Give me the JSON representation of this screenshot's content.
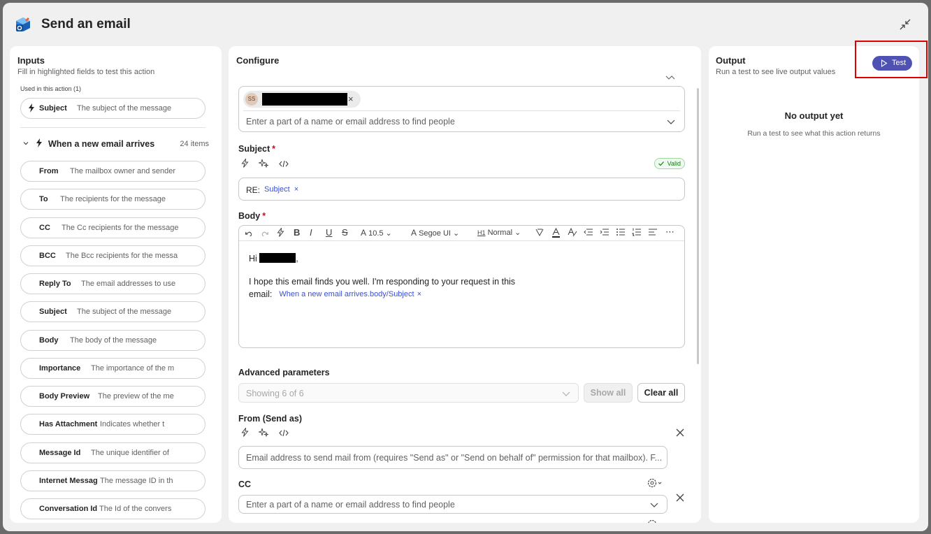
{
  "dialog": {
    "title": "Send an email",
    "app_icon": "outlook-cube-icon",
    "collapse_icon": "collapse-arrows-icon"
  },
  "inputs": {
    "title": "Inputs",
    "subtitle": "Fill in highlighted fields to test this action",
    "used_label": "Used in this action (1)",
    "used_items": [
      {
        "name": "Subject",
        "desc": "The subject of the message"
      }
    ],
    "group": {
      "label": "When a new email arrives",
      "count": "24 items"
    },
    "items": [
      {
        "name": "From",
        "desc": "The mailbox owner and sender"
      },
      {
        "name": "To",
        "desc": "The recipients for the message"
      },
      {
        "name": "CC",
        "desc": "The Cc recipients for the message"
      },
      {
        "name": "BCC",
        "desc": "The Bcc recipients for the messa"
      },
      {
        "name": "Reply To",
        "desc": "The email addresses to use"
      },
      {
        "name": "Subject",
        "desc": "The subject of the message"
      },
      {
        "name": "Body",
        "desc": "The body of the message"
      },
      {
        "name": "Importance",
        "desc": "The importance of the m"
      },
      {
        "name": "Body Preview",
        "desc": "The preview of the me"
      },
      {
        "name": "Has Attachment",
        "desc": "Indicates whether t"
      },
      {
        "name": "Message Id",
        "desc": "The unique identifier of"
      },
      {
        "name": "Internet Messag",
        "desc": "The message ID in th"
      },
      {
        "name": "Conversation Id",
        "desc": "The Id of the convers"
      }
    ]
  },
  "configure": {
    "title": "Configure",
    "to": {
      "chip_initials": "SS",
      "placeholder": "Enter a part of a name or email address to find people"
    },
    "subject": {
      "label": "Subject",
      "required_mark": "*",
      "valid_label": "Valid",
      "prefix": "RE:",
      "token": "Subject",
      "token_remove": "×"
    },
    "body": {
      "label": "Body",
      "required_mark": "*",
      "font_size": "10.5",
      "font_name": "Segoe UI",
      "style": "Normal",
      "greeting": "Hi",
      "greeting_suffix": ",",
      "line1": "I hope this email finds you well. I'm responding to your request in this",
      "line2": "email:",
      "token": "When a new email arrives.body/Subject",
      "token_remove": "×"
    },
    "advanced": {
      "label": "Advanced parameters",
      "dropdown_value": "Showing 6 of 6",
      "show_all": "Show all",
      "clear_all": "Clear all"
    },
    "from": {
      "label": "From (Send as)",
      "placeholder": "Email address to send mail from (requires \"Send as\" or \"Send on behalf of\" permission for that mailbox). F..."
    },
    "cc": {
      "label": "CC",
      "placeholder": "Enter a part of a name or email address to find people"
    }
  },
  "output": {
    "title": "Output",
    "subtitle": "Run a test to see live output values",
    "test_label": "Test",
    "empty_title": "No output yet",
    "empty_subtitle": "Run a test to see what this action returns"
  },
  "colors": {
    "accent": "#4f52b2",
    "token": "#3b4fd1",
    "valid": "#107c10",
    "required": "#c50f1f",
    "highlight": "#e00000"
  }
}
